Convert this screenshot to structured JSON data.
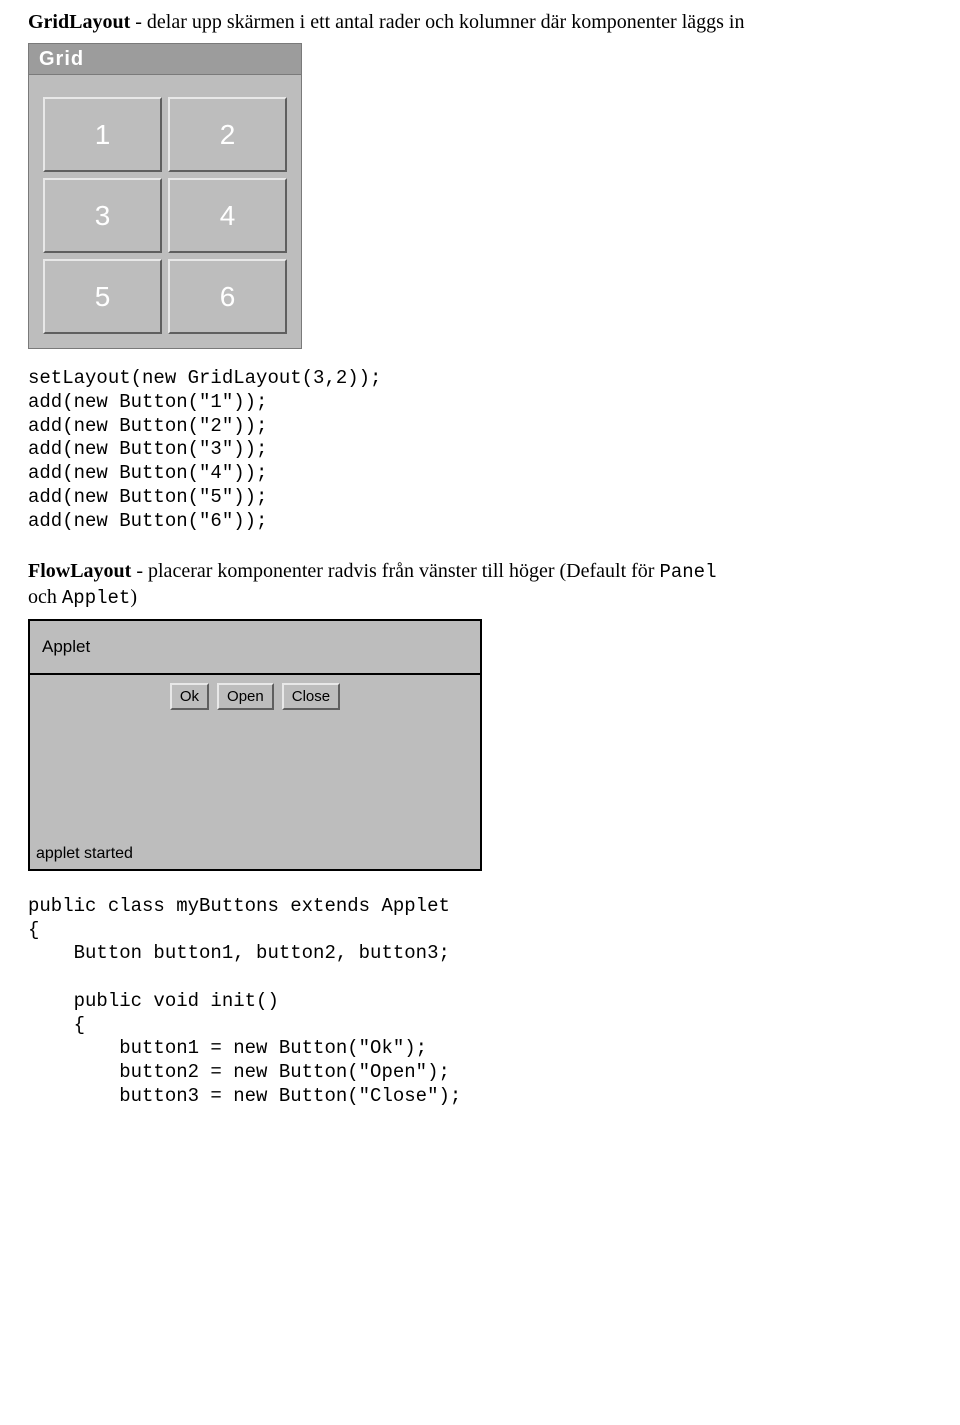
{
  "section1": {
    "heading_bold": "GridLayout",
    "heading_rest": " - delar upp skärmen i ett antal rader och kolumner där komponenter läggs in"
  },
  "grid_window": {
    "title": "Grid",
    "buttons": [
      "1",
      "2",
      "3",
      "4",
      "5",
      "6"
    ]
  },
  "code1": "setLayout(new GridLayout(3,2));\nadd(new Button(\"1\"));\nadd(new Button(\"2\"));\nadd(new Button(\"3\"));\nadd(new Button(\"4\"));\nadd(new Button(\"5\"));\nadd(new Button(\"6\"));",
  "section2": {
    "heading_bold": "FlowLayout",
    "heading_rest_a": " - placerar komponenter radvis från vänster till höger (Default för ",
    "mono_a": "Panel",
    "rest_b": " och ",
    "mono_b": "Applet",
    "rest_c": ")"
  },
  "applet_window": {
    "label": "Applet",
    "buttons": [
      "Ok",
      "Open",
      "Close"
    ],
    "status": "applet started"
  },
  "code2": "public class myButtons extends Applet\n{\n    Button button1, button2, button3;\n\n    public void init()\n    {\n        button1 = new Button(\"Ok\");\n        button2 = new Button(\"Open\");\n        button3 = new Button(\"Close\");"
}
